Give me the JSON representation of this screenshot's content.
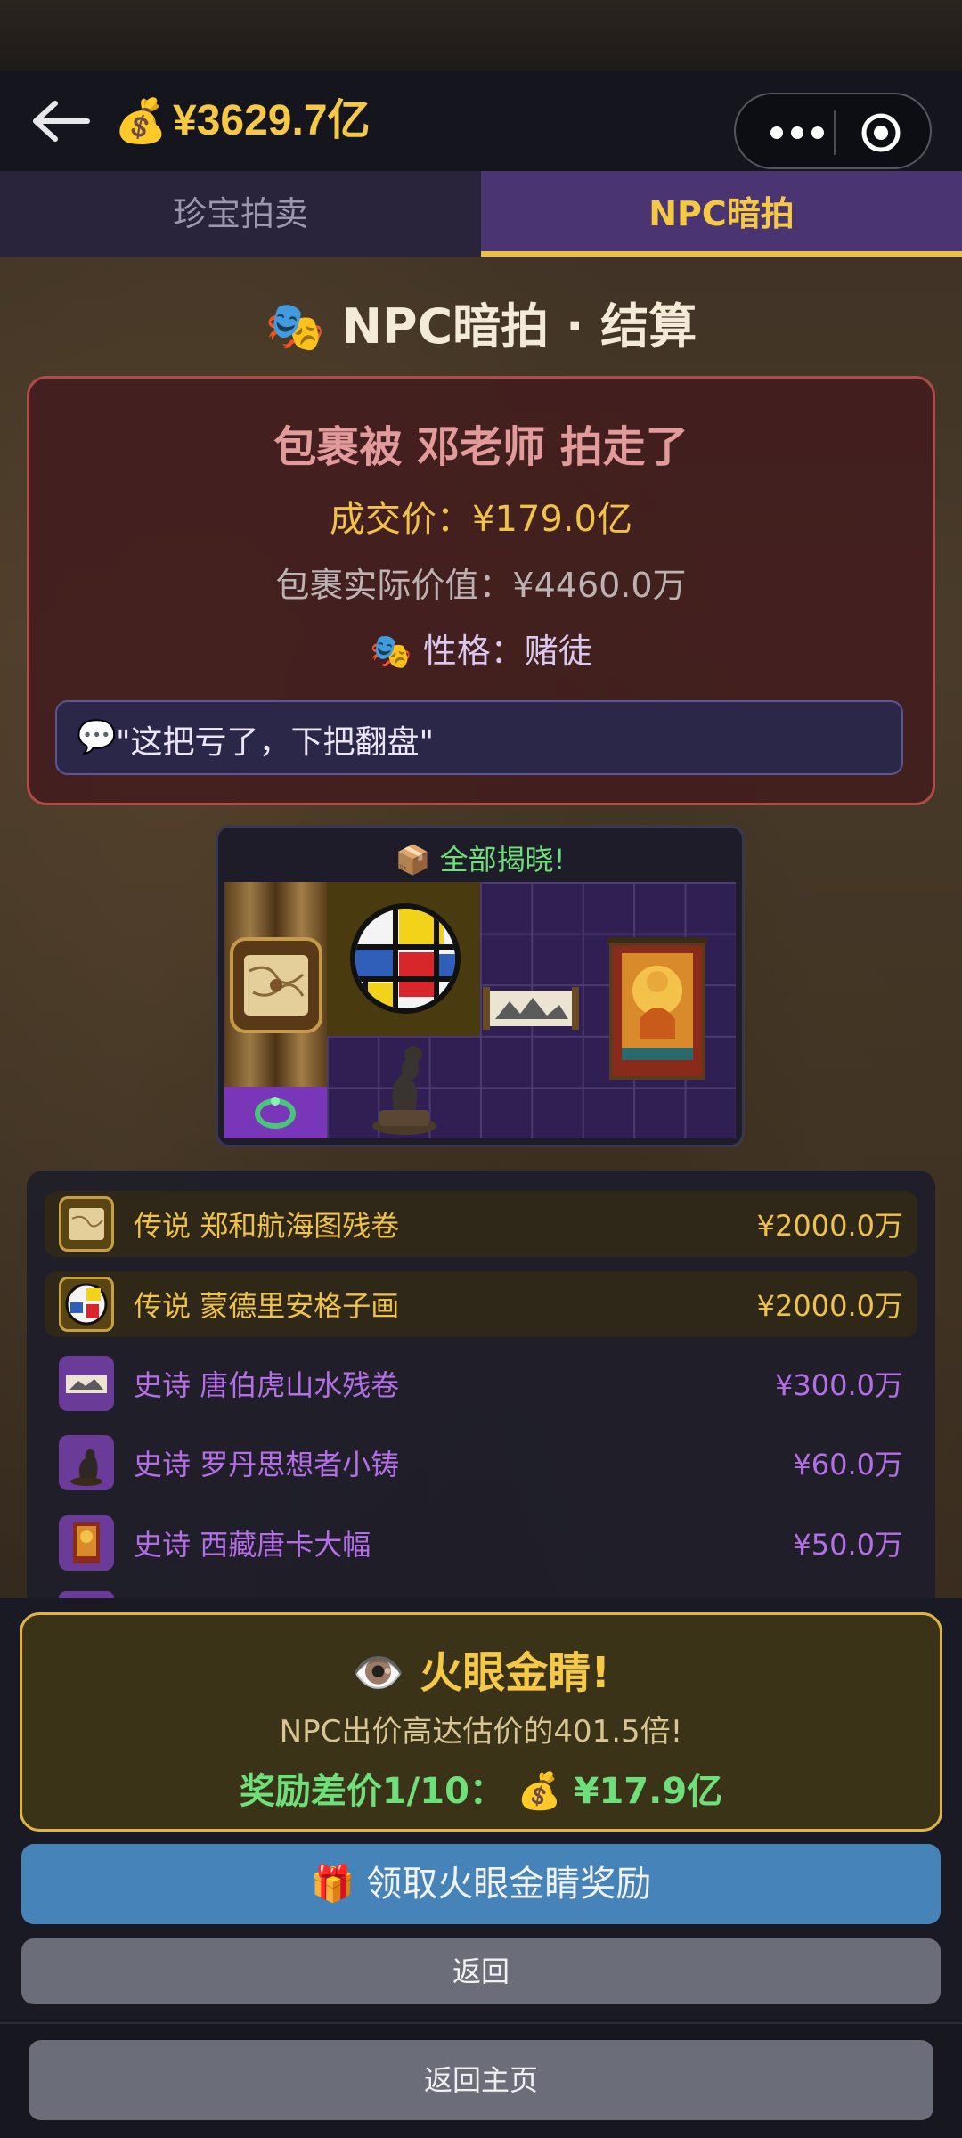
{
  "header": {
    "balance": "¥3629.7亿",
    "coin_icon": "money-bag-icon"
  },
  "tabs": [
    {
      "label": "珍宝拍卖",
      "active": false
    },
    {
      "label": "NPC暗拍",
      "active": true
    }
  ],
  "settlement": {
    "title": "NPC暗拍 · 结算",
    "taken_text": "包裹被 邓老师 拍走了",
    "deal_price": "成交价：¥179.0亿",
    "actual_value": "包裹实际价值：¥4460.0万",
    "personality": "性格：赌徒",
    "quote": "\"这把亏了，下把翻盘\""
  },
  "reveal": {
    "title": "全部揭晓!"
  },
  "items": [
    {
      "rarity": "传说",
      "name": "郑和航海图残卷",
      "value": "¥2000.0万",
      "icon": "scroll-map-icon"
    },
    {
      "rarity": "传说",
      "name": "蒙德里安格子画",
      "value": "¥2000.0万",
      "icon": "mondrian-painting-icon"
    },
    {
      "rarity": "史诗",
      "name": "唐伯虎山水残卷",
      "value": "¥300.0万",
      "icon": "landscape-scroll-icon"
    },
    {
      "rarity": "史诗",
      "name": "罗丹思想者小铸",
      "value": "¥60.0万",
      "icon": "thinker-statue-icon"
    },
    {
      "rarity": "史诗",
      "name": "西藏唐卡大幅",
      "value": "¥50.0万",
      "icon": "thangka-icon"
    }
  ],
  "reward": {
    "title": "火眼金睛!",
    "description": "NPC出价高达估价的401.5倍!",
    "bonus": "奖励差价1/10：",
    "bonus_amount": "¥17.9亿",
    "claim_button": "领取火眼金睛奖励",
    "back_button": "返回"
  },
  "footer": {
    "home_button": "返回主页"
  },
  "colors": {
    "gold": "#f6c945",
    "legend": "#f0c246",
    "epic": "#b66ee8",
    "green": "#6ee07a",
    "claim_blue": "#4583b8"
  }
}
